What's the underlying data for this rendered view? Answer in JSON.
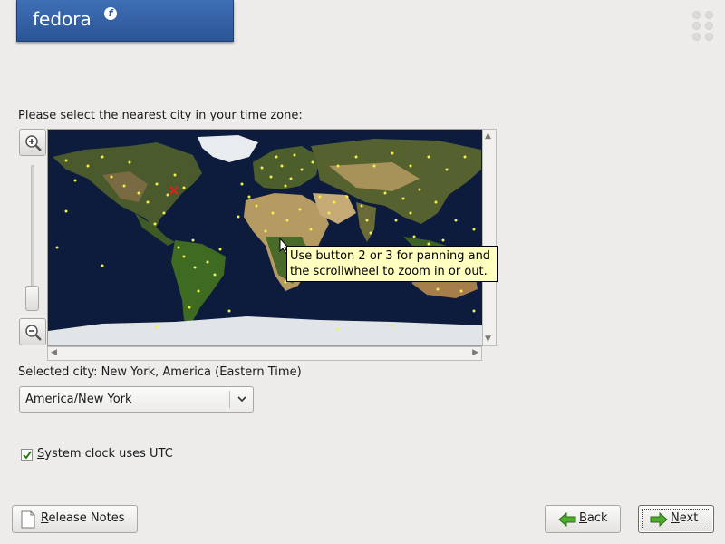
{
  "header": {
    "logo_text": "fedora",
    "logo_mark": "f"
  },
  "timezone": {
    "prompt": "Please select the nearest city in your time zone:",
    "tooltip_line1": "Use button 2 or 3 for panning and",
    "tooltip_line2": "the scrollwheel to zoom in or out.",
    "selected_city_label": "Selected city: New York, America (Eastern Time)",
    "combo_value": "America/New York",
    "utc_checkbox": {
      "prefix": "",
      "accel": "S",
      "rest": "ystem clock uses UTC",
      "checked": true
    }
  },
  "buttons": {
    "release_notes": {
      "accel": "R",
      "rest": "elease Notes"
    },
    "back": {
      "accel": "B",
      "rest": "ack"
    },
    "next": {
      "accel": "N",
      "rest": "ext"
    }
  },
  "icons": {
    "zoom_in": "zoom-in-icon",
    "zoom_out": "zoom-out-icon",
    "back": "green-left-arrow-icon",
    "next": "green-right-arrow-icon",
    "release_notes": "document-icon"
  },
  "colors": {
    "banner": "#2b5597",
    "tooltip": "#ffffbf",
    "city_dot": "#f2f04a",
    "selected_city": "#e02020",
    "arrow": "#3a9a1c"
  }
}
